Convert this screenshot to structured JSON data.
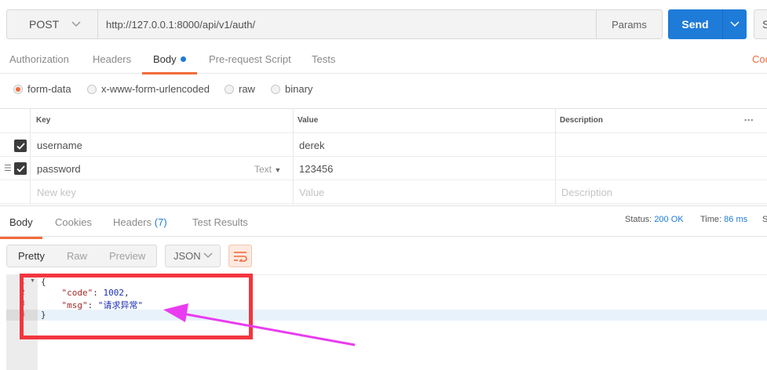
{
  "request": {
    "method": "POST",
    "url": "http://127.0.0.1:8000/api/v1/auth/",
    "params_label": "Params",
    "send_label": "Send",
    "save_label": "S"
  },
  "request_tabs": [
    {
      "label": "Authorization"
    },
    {
      "label": "Headers"
    },
    {
      "label": "Body"
    },
    {
      "label": "Pre-request Script"
    },
    {
      "label": "Tests"
    }
  ],
  "cookies_label": "Coo",
  "body_types": [
    {
      "label": "form-data",
      "selected": true
    },
    {
      "label": "x-www-form-urlencoded",
      "selected": false
    },
    {
      "label": "raw",
      "selected": false
    },
    {
      "label": "binary",
      "selected": false
    }
  ],
  "kv_table": {
    "headers": {
      "key": "Key",
      "value": "Value",
      "description": "Description"
    },
    "more": "•••",
    "rows": [
      {
        "key": "username",
        "value": "derek",
        "type": ""
      },
      {
        "key": "password",
        "value": "123456",
        "type": "Text"
      }
    ],
    "placeholders": {
      "key": "New key",
      "value": "Value",
      "description": "Description"
    }
  },
  "response_tabs": [
    {
      "label": "Body"
    },
    {
      "label": "Cookies"
    },
    {
      "label": "Headers",
      "count": "(7)"
    },
    {
      "label": "Test Results"
    }
  ],
  "status": {
    "status_label": "Status:",
    "status_value": "200 OK",
    "time_label": "Time:",
    "time_value": "86 ms",
    "size_label": "S"
  },
  "view_tabs": [
    {
      "label": "Pretty"
    },
    {
      "label": "Raw"
    },
    {
      "label": "Preview"
    }
  ],
  "format": "JSON",
  "code": {
    "line_numbers": [
      "1",
      "2",
      "3",
      "4"
    ],
    "lines": {
      "l1": "{",
      "l2_key": "\"code\"",
      "l2_val": "1002",
      "l3_key": "\"msg\"",
      "l3_val": "\"请求异常\"",
      "l4": "}"
    }
  },
  "colors": {
    "accent": "#f26b3a",
    "primary": "#1e7bd8",
    "annotation_box": "#f2363f",
    "annotation_arrow": "#e93cf0"
  }
}
